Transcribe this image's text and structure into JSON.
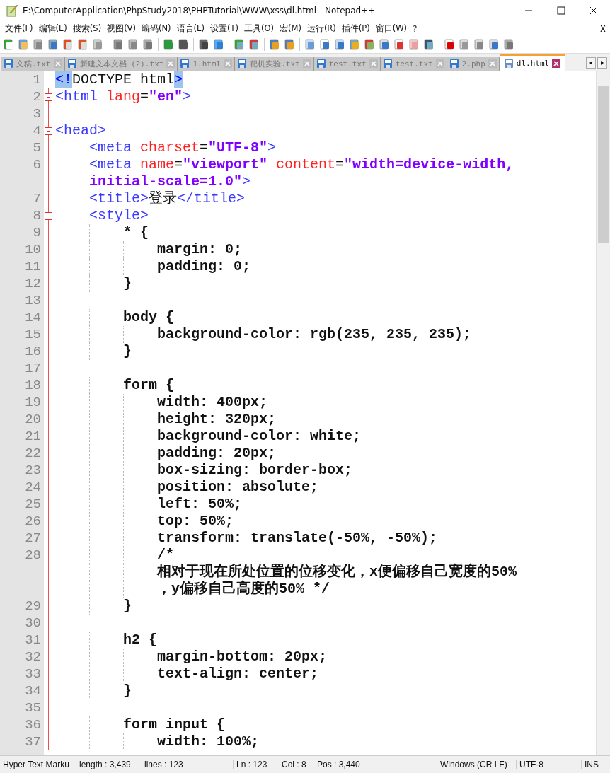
{
  "window": {
    "title": "E:\\ComputerApplication\\PhpStudy2018\\PHPTutorial\\WWW\\xss\\dl.html - Notepad++"
  },
  "menu": [
    "文件(F)",
    "编辑(E)",
    "搜索(S)",
    "视图(V)",
    "编码(N)",
    "语言(L)",
    "设置(T)",
    "工具(O)",
    "宏(M)",
    "运行(R)",
    "插件(P)",
    "窗口(W)",
    "?"
  ],
  "menu_close": "X",
  "tabs": [
    {
      "label": "文稿.txt",
      "selected": false
    },
    {
      "label": "新建文本文档 (2).txt",
      "selected": false
    },
    {
      "label": "1.html",
      "selected": false
    },
    {
      "label": "靶机实验.txt",
      "selected": false
    },
    {
      "label": "test.txt",
      "selected": false
    },
    {
      "label": "test.txt",
      "selected": false
    },
    {
      "label": "2.php",
      "selected": false
    },
    {
      "label": "dl.html",
      "selected": true
    }
  ],
  "lines": [
    {
      "num": "1",
      "fold_marker": false,
      "segments": [
        {
          "text": "<!",
          "kind": "match"
        },
        {
          "text": "DOCTYPE html",
          "kind": "plain"
        },
        {
          "text": ">",
          "kind": "match"
        }
      ]
    },
    {
      "num": "2",
      "fold_marker": true,
      "segments": [
        {
          "text": "<html ",
          "kind": "tag"
        },
        {
          "text": "lang",
          "kind": "attr"
        },
        {
          "text": "=",
          "kind": "plain"
        },
        {
          "text": "\"en\"",
          "kind": "string"
        },
        {
          "text": ">",
          "kind": "tag"
        }
      ]
    },
    {
      "num": "3",
      "fold_marker": false
    },
    {
      "num": "4",
      "fold_marker": true,
      "segments": [
        {
          "text": "<head>",
          "kind": "tag"
        }
      ]
    },
    {
      "num": "5",
      "fold_marker": false,
      "segments": [
        {
          "text": "    <meta ",
          "kind": "tag"
        },
        {
          "text": "charset",
          "kind": "attr"
        },
        {
          "text": "=",
          "kind": "plain"
        },
        {
          "text": "\"UTF-8\"",
          "kind": "string"
        },
        {
          "text": ">",
          "kind": "tag"
        }
      ]
    },
    {
      "num": "6",
      "fold_marker": false,
      "segments": [
        {
          "text": "    <meta ",
          "kind": "tag"
        },
        {
          "text": "name",
          "kind": "attr"
        },
        {
          "text": "=",
          "kind": "plain"
        },
        {
          "text": "\"viewport\"",
          "kind": "string"
        },
        {
          "text": " content",
          "kind": "attr"
        },
        {
          "text": "=",
          "kind": "plain"
        },
        {
          "text": "\"width=device-width,",
          "kind": "string"
        }
      ],
      "continued": [
        {
          "segments": [
            {
              "text": "    initial-scale=1.0\"",
              "kind": "string"
            },
            {
              "text": ">",
              "kind": "tag"
            }
          ]
        }
      ]
    },
    {
      "num": "7",
      "fold_marker": false,
      "segments": [
        {
          "text": "    <title>",
          "kind": "tag"
        },
        {
          "text": "登录",
          "kind": "plain"
        },
        {
          "text": "</title>",
          "kind": "tag"
        }
      ]
    },
    {
      "num": "8",
      "fold_marker": true,
      "segments": [
        {
          "text": "    <style>",
          "kind": "tag"
        }
      ]
    },
    {
      "num": "9",
      "fold_marker": false,
      "segments": [
        {
          "text": "        * {",
          "kind": "css"
        }
      ]
    },
    {
      "num": "10",
      "fold_marker": false,
      "segments": [
        {
          "text": "            margin: 0;",
          "kind": "css"
        }
      ]
    },
    {
      "num": "11",
      "fold_marker": false,
      "segments": [
        {
          "text": "            padding: 0;",
          "kind": "css"
        }
      ]
    },
    {
      "num": "12",
      "fold_marker": false,
      "segments": [
        {
          "text": "        }",
          "kind": "css"
        }
      ]
    },
    {
      "num": "13",
      "fold_marker": false
    },
    {
      "num": "14",
      "fold_marker": false,
      "segments": [
        {
          "text": "        body {",
          "kind": "css"
        }
      ]
    },
    {
      "num": "15",
      "fold_marker": false,
      "segments": [
        {
          "text": "            background-color: rgb(235, 235, 235);",
          "kind": "css"
        }
      ]
    },
    {
      "num": "16",
      "fold_marker": false,
      "segments": [
        {
          "text": "        }",
          "kind": "css"
        }
      ]
    },
    {
      "num": "17",
      "fold_marker": false
    },
    {
      "num": "18",
      "fold_marker": false,
      "segments": [
        {
          "text": "        form {",
          "kind": "css"
        }
      ]
    },
    {
      "num": "19",
      "fold_marker": false,
      "segments": [
        {
          "text": "            width: 400px;",
          "kind": "css"
        }
      ]
    },
    {
      "num": "20",
      "fold_marker": false,
      "segments": [
        {
          "text": "            height: 320px;",
          "kind": "css"
        }
      ]
    },
    {
      "num": "21",
      "fold_marker": false,
      "segments": [
        {
          "text": "            background-color: white;",
          "kind": "css"
        }
      ]
    },
    {
      "num": "22",
      "fold_marker": false,
      "segments": [
        {
          "text": "            padding: 20px;",
          "kind": "css"
        }
      ]
    },
    {
      "num": "23",
      "fold_marker": false,
      "segments": [
        {
          "text": "            box-sizing: border-box;",
          "kind": "css"
        }
      ]
    },
    {
      "num": "24",
      "fold_marker": false,
      "segments": [
        {
          "text": "            position: absolute;",
          "kind": "css"
        }
      ]
    },
    {
      "num": "25",
      "fold_marker": false,
      "segments": [
        {
          "text": "            left: 50%;",
          "kind": "css"
        }
      ]
    },
    {
      "num": "26",
      "fold_marker": false,
      "segments": [
        {
          "text": "            top: 50%;",
          "kind": "css"
        }
      ]
    },
    {
      "num": "27",
      "fold_marker": false,
      "segments": [
        {
          "text": "            transform: translate(-50%, -50%);",
          "kind": "css"
        }
      ]
    },
    {
      "num": "28",
      "fold_marker": false,
      "segments": [
        {
          "text": "            /*",
          "kind": "css"
        }
      ],
      "continued": [
        {
          "segments": [
            {
              "text": "            相对于现在所处位置的位移变化，x便偏移自己宽度的50%",
              "kind": "css"
            }
          ]
        },
        {
          "segments": [
            {
              "text": "            ，y偏移自己高度的50% */",
              "kind": "css"
            }
          ]
        }
      ]
    },
    {
      "num": "29",
      "fold_marker": false,
      "segments": [
        {
          "text": "        }",
          "kind": "css"
        }
      ]
    },
    {
      "num": "30",
      "fold_marker": false
    },
    {
      "num": "31",
      "fold_marker": false,
      "segments": [
        {
          "text": "        h2 {",
          "kind": "css"
        }
      ]
    },
    {
      "num": "32",
      "fold_marker": false,
      "segments": [
        {
          "text": "            margin-bottom: 20px;",
          "kind": "css"
        }
      ]
    },
    {
      "num": "33",
      "fold_marker": false,
      "segments": [
        {
          "text": "            text-align: center;",
          "kind": "css"
        }
      ]
    },
    {
      "num": "34",
      "fold_marker": false,
      "segments": [
        {
          "text": "        }",
          "kind": "css"
        }
      ]
    },
    {
      "num": "35",
      "fold_marker": false
    },
    {
      "num": "36",
      "fold_marker": false,
      "segments": [
        {
          "text": "        form input {",
          "kind": "css"
        }
      ]
    },
    {
      "num": "37",
      "fold_marker": false,
      "segments": [
        {
          "text": "            width: 100%;",
          "kind": "css"
        }
      ]
    }
  ],
  "status_bar": {
    "language": "Hyper Text Marku",
    "length": "length : 3,439",
    "lines": "lines : 123",
    "ln": "Ln : 123",
    "col": "Col : 8",
    "pos": "Pos : 3,440",
    "eol": "Windows (CR LF)",
    "encoding": "UTF-8",
    "mode": "INS"
  }
}
